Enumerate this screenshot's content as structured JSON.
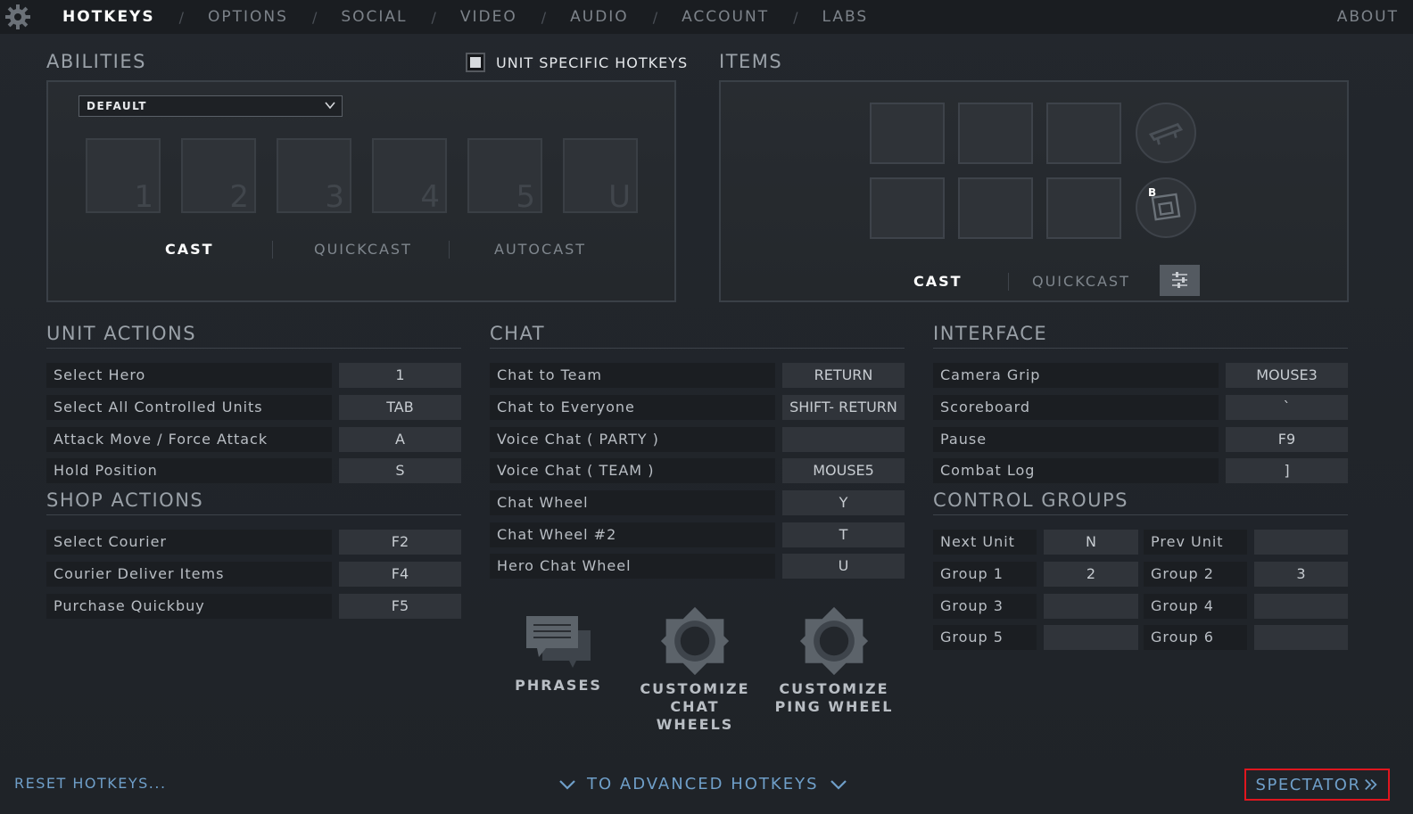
{
  "nav": {
    "tabs": [
      "HOTKEYS",
      "OPTIONS",
      "SOCIAL",
      "VIDEO",
      "AUDIO",
      "ACCOUNT",
      "LABS"
    ],
    "active": "HOTKEYS",
    "separator": "/",
    "about": "ABOUT"
  },
  "abilities": {
    "title": "ABILITIES",
    "unit_specific_label": "UNIT SPECIFIC HOTKEYS",
    "unit_specific_checked": true,
    "dropdown_value": "DEFAULT",
    "slot_keys": [
      "1",
      "2",
      "3",
      "4",
      "5",
      "U"
    ],
    "modes": [
      "CAST",
      "QUICKCAST",
      "AUTOCAST"
    ],
    "active_mode": "CAST"
  },
  "items": {
    "title": "ITEMS",
    "courier_key": "B",
    "modes": [
      "CAST",
      "QUICKCAST"
    ],
    "active_mode": "CAST"
  },
  "unit_actions": {
    "title": "UNIT ACTIONS",
    "rows": [
      {
        "label": "Select Hero",
        "key": "1"
      },
      {
        "label": "Select All Controlled Units",
        "key": "TAB"
      },
      {
        "label": "Attack Move / Force Attack",
        "key": "A"
      },
      {
        "label": "Hold Position",
        "key": "S"
      }
    ]
  },
  "shop_actions": {
    "title": "SHOP ACTIONS",
    "rows": [
      {
        "label": "Select Courier",
        "key": "F2"
      },
      {
        "label": "Courier Deliver Items",
        "key": "F4"
      },
      {
        "label": "Purchase Quickbuy",
        "key": "F5"
      }
    ]
  },
  "chat": {
    "title": "CHAT",
    "rows": [
      {
        "label": "Chat to Team",
        "key": "RETURN"
      },
      {
        "label": "Chat to Everyone",
        "key": "SHIFT- RETURN"
      },
      {
        "label": "Voice Chat ( PARTY )",
        "key": ""
      },
      {
        "label": "Voice Chat ( TEAM )",
        "key": "MOUSE5"
      },
      {
        "label": "Chat Wheel",
        "key": "Y"
      },
      {
        "label": "Chat Wheel #2",
        "key": "T"
      },
      {
        "label": "Hero Chat Wheel",
        "key": "U"
      }
    ],
    "buttons": {
      "phrases": "PHRASES",
      "chat_wheels_1": "CUSTOMIZE",
      "chat_wheels_2": "CHAT WHEELS",
      "ping_wheel_1": "CUSTOMIZE",
      "ping_wheel_2": "PING WHEEL"
    }
  },
  "interface": {
    "title": "INTERFACE",
    "rows": [
      {
        "label": "Camera Grip",
        "key": "MOUSE3"
      },
      {
        "label": "Scoreboard",
        "key": "`"
      },
      {
        "label": "Pause",
        "key": "F9"
      },
      {
        "label": "Combat Log",
        "key": "]"
      }
    ]
  },
  "control_groups": {
    "title": "CONTROL GROUPS",
    "rows": [
      {
        "l1": "Next Unit",
        "k1": "N",
        "l2": "Prev Unit",
        "k2": ""
      },
      {
        "l1": "Group 1",
        "k1": "2",
        "l2": "Group 2",
        "k2": "3"
      },
      {
        "l1": "Group 3",
        "k1": "",
        "l2": "Group 4",
        "k2": ""
      },
      {
        "l1": "Group 5",
        "k1": "",
        "l2": "Group 6",
        "k2": ""
      }
    ]
  },
  "footer": {
    "reset": "RESET HOTKEYS...",
    "advanced": "TO ADVANCED HOTKEYS",
    "spectator": "SPECTATOR"
  },
  "colors": {
    "accent_link": "#6f9fc9",
    "highlight_border": "#e0161e"
  }
}
